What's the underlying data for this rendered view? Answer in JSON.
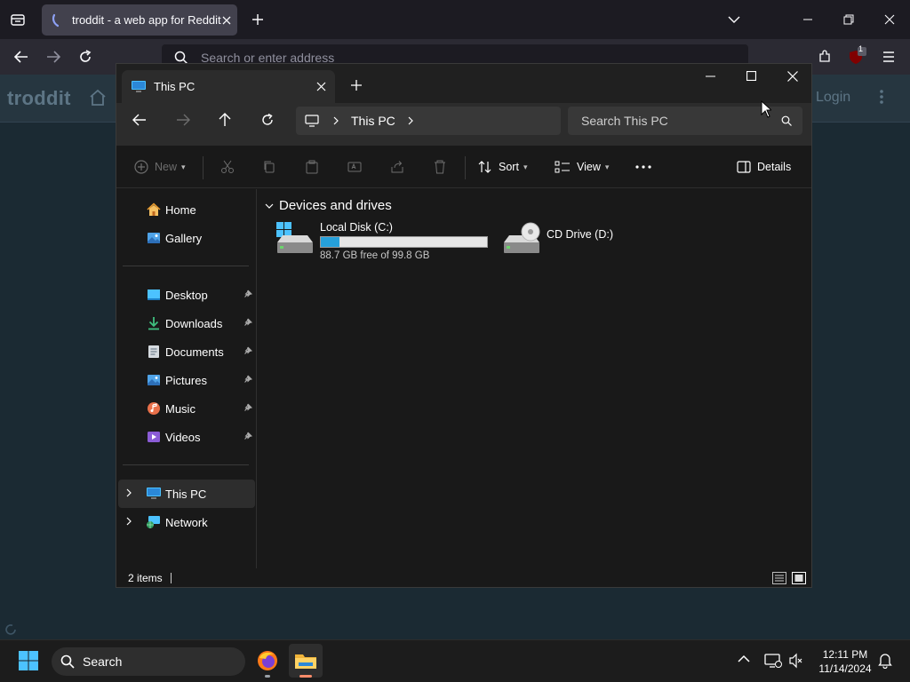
{
  "browser": {
    "tab_title": "troddit - a web app for Reddit",
    "address_placeholder": "Search or enter address",
    "badge_count": "1"
  },
  "webpage": {
    "logo": "troddit",
    "login": "Login"
  },
  "explorer": {
    "tab_title": "This PC",
    "breadcrumb": "This PC",
    "search_placeholder": "Search This PC",
    "commands": {
      "new": "New",
      "sort": "Sort",
      "view": "View",
      "details": "Details"
    },
    "sidebar": {
      "top": [
        {
          "label": "Home",
          "icon": "home-icon"
        },
        {
          "label": "Gallery",
          "icon": "gallery-icon"
        }
      ],
      "quick_access": [
        {
          "label": "Desktop",
          "icon": "desktop-icon"
        },
        {
          "label": "Downloads",
          "icon": "downloads-icon"
        },
        {
          "label": "Documents",
          "icon": "documents-icon"
        },
        {
          "label": "Pictures",
          "icon": "pictures-icon"
        },
        {
          "label": "Music",
          "icon": "music-icon"
        },
        {
          "label": "Videos",
          "icon": "videos-icon"
        }
      ],
      "tree": [
        {
          "label": "This PC",
          "icon": "this-pc-icon",
          "selected": true
        },
        {
          "label": "Network",
          "icon": "network-icon",
          "selected": false
        }
      ]
    },
    "content": {
      "group_header": "Devices and drives",
      "drives": [
        {
          "name": "Local Disk (C:)",
          "free_text": "88.7 GB free of 99.8 GB",
          "used_fraction": 0.111
        },
        {
          "name": "CD Drive (D:)"
        }
      ]
    },
    "status": {
      "item_count": "2 items"
    }
  },
  "taskbar": {
    "search_label": "Search",
    "time": "12:11 PM",
    "date": "11/14/2024"
  },
  "colors": {
    "accent": "#26a0da",
    "window_bg": "#191919",
    "page_bg": "#1b2a33"
  }
}
